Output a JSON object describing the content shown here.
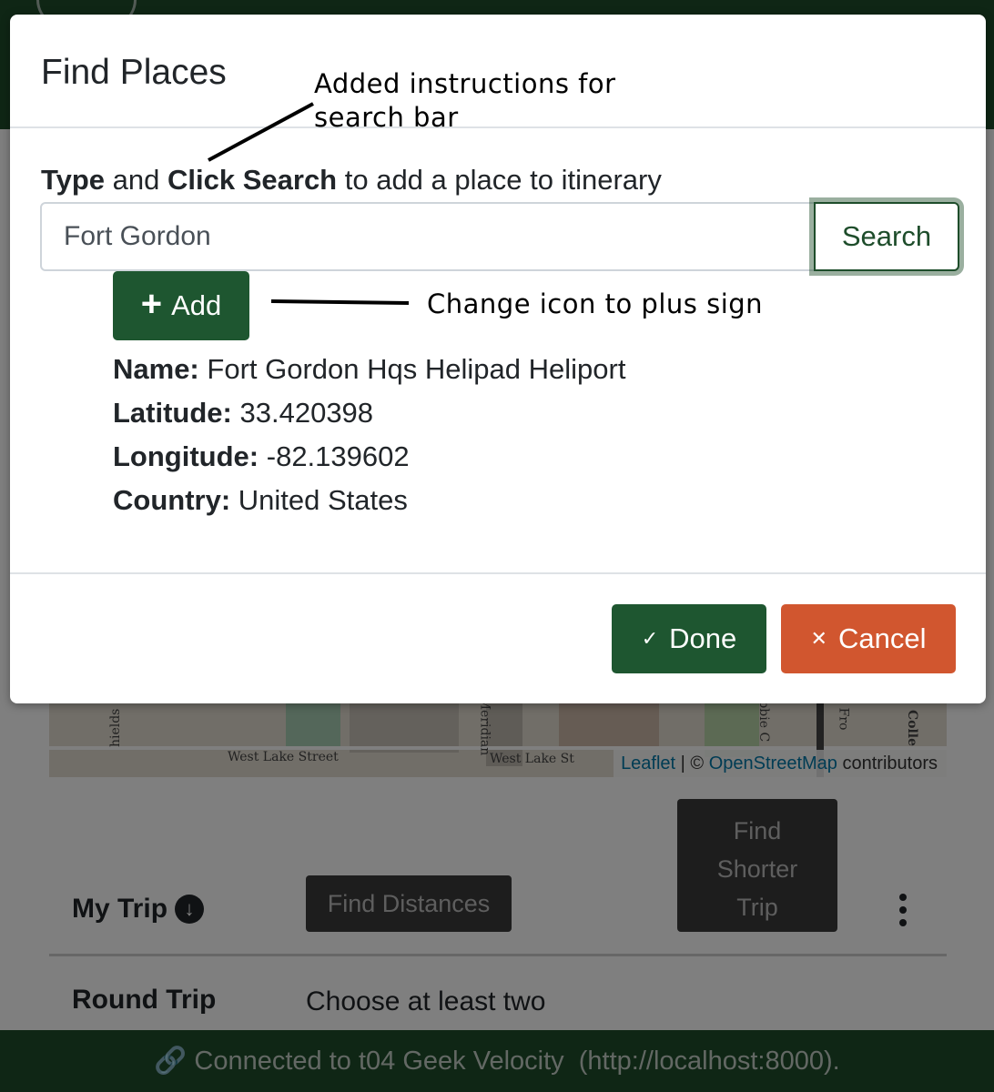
{
  "background": {
    "map": {
      "streets": [
        "hields St",
        "West Lake Street",
        "Meridian",
        "West Lake St",
        "ibbie C",
        "Fro",
        "Colle"
      ],
      "attribution": {
        "leaflet": "Leaflet",
        "separator": " | © ",
        "osm": "OpenStreetMap",
        "suffix": " contributors"
      }
    },
    "trip": {
      "title": "My Trip",
      "find_distances": "Find Distances",
      "find_shorter_line1": "Find",
      "find_shorter_line2": "Shorter",
      "find_shorter_line3": "Trip",
      "round_trip_label": "Round Trip",
      "round_trip_value": "Choose at least two"
    },
    "footer": {
      "icon": "link-icon",
      "text": "Connected to t04 Geek Velocity  (http://localhost:8000)."
    }
  },
  "modal": {
    "title": "Find Places",
    "instruction": {
      "part1": "Type",
      "part2": " and ",
      "part3": "Click Search",
      "part4": " to add a place to itinerary"
    },
    "search": {
      "value": "Fort Gordon",
      "button": "Search"
    },
    "add_button": "Add",
    "result": {
      "name_label": "Name:",
      "name": "Fort Gordon Hqs Helipad Heliport",
      "lat_label": "Latitude:",
      "lat": "33.420398",
      "lon_label": "Longitude:",
      "lon": "-82.139602",
      "country_label": "Country:",
      "country": "United States"
    },
    "done_button": "Done",
    "cancel_button": "Cancel"
  },
  "annotations": {
    "search_bar_line1": "Added instructions for",
    "search_bar_line2": "search bar",
    "icon_note": "Change icon to plus sign"
  },
  "colors": {
    "brand_green": "#1e4d2b",
    "cancel_orange": "#d1562f"
  }
}
